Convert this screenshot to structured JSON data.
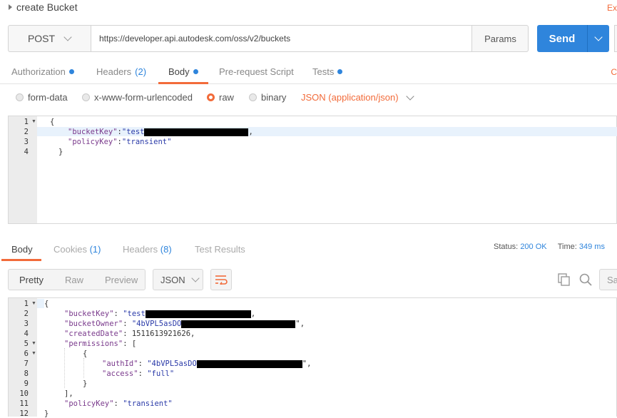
{
  "request": {
    "title": "create Bucket",
    "top_right_edge": "Ex",
    "method": "POST",
    "url": "https://developer.api.autodesk.com/oss/v2/buckets",
    "params_label": "Params",
    "send_label": "Send"
  },
  "tabs": [
    {
      "label": "Authorization",
      "count": ""
    },
    {
      "label": "Headers",
      "count": "(2)"
    },
    {
      "label": "Body",
      "count": ""
    },
    {
      "label": "Pre-request Script",
      "count": ""
    },
    {
      "label": "Tests",
      "count": ""
    }
  ],
  "tabs_right_edge": "C",
  "body_types": {
    "form_data": "form-data",
    "urlencoded": "x-www-form-urlencoded",
    "raw": "raw",
    "binary": "binary",
    "content_type": "JSON (application/json)"
  },
  "request_body": {
    "line_numbers": [
      "1",
      "2",
      "3",
      "4"
    ],
    "open": "{",
    "bucket_key_key": "\"bucketKey\"",
    "bucket_key_value": "\"test",
    "policy_key_key": "\"policyKey\"",
    "policy_key_value": "\"transient\"",
    "close": "}"
  },
  "response_tabs": [
    {
      "label": "Body",
      "count": ""
    },
    {
      "label": "Cookies",
      "count": "(1)"
    },
    {
      "label": "Headers",
      "count": "(8)"
    },
    {
      "label": "Test Results",
      "count": ""
    }
  ],
  "status": {
    "status_label": "Status:",
    "status_value": "200 OK",
    "time_label": "Time:",
    "time_value": "349 ms"
  },
  "view_modes": {
    "pretty": "Pretty",
    "raw": "Raw",
    "preview": "Preview"
  },
  "format": "JSON",
  "save_edge": "Sav",
  "response_body": {
    "line_numbers": [
      "1",
      "2",
      "3",
      "4",
      "5",
      "6",
      "7",
      "8",
      "9",
      "10",
      "11",
      "12"
    ],
    "bucket_key_key": "\"bucketKey\"",
    "bucket_key_value": "\"test",
    "bucket_owner_key": "\"bucketOwner\"",
    "bucket_owner_value": "\"4bVPL5asDO",
    "created_date_key": "\"createdDate\"",
    "created_date_value": "1511613921626",
    "permissions_key": "\"permissions\"",
    "auth_id_key": "\"authId\"",
    "auth_id_value": "\"4bVPL5asDO",
    "access_key": "\"access\"",
    "access_value": "\"full\"",
    "policy_key_key": "\"policyKey\"",
    "policy_key_value": "\"transient\""
  }
}
